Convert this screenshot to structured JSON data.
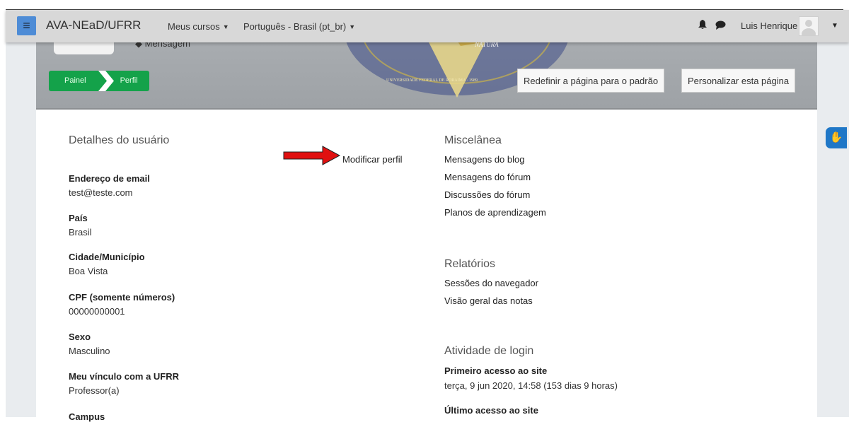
{
  "navbar": {
    "brand": "AVA-NEaD/UFRR",
    "menu_courses": "Meus cursos",
    "menu_language": "Português - Brasil (pt_br)",
    "user_name": "Luis Henrique"
  },
  "header": {
    "message_link": "Mensagem",
    "breadcrumb": [
      "Painel",
      "Perfil"
    ],
    "reset_button": "Redefinir a página para o padrão",
    "customize_button": "Personalizar esta página",
    "logo_text_top": "NATURA",
    "logo_text_ring": "UNIVERSIDADE FEDERAL DE RORAIMA · 1989"
  },
  "user_details": {
    "title": "Detalhes do usuário",
    "edit_link": "Modificar perfil",
    "fields": [
      {
        "label": "Endereço de email",
        "value": "test@teste.com"
      },
      {
        "label": "País",
        "value": "Brasil"
      },
      {
        "label": "Cidade/Município",
        "value": "Boa Vista"
      },
      {
        "label": "CPF (somente números)",
        "value": "00000000001"
      },
      {
        "label": "Sexo",
        "value": "Masculino"
      },
      {
        "label": "Meu vínculo com a UFRR",
        "value": "Professor(a)"
      },
      {
        "label": "Campus",
        "value": ""
      }
    ]
  },
  "misc": {
    "title": "Miscelânea",
    "links": [
      "Mensagens do blog",
      "Mensagens do fórum",
      "Discussões do fórum",
      "Planos de aprendizagem"
    ]
  },
  "reports": {
    "title": "Relatórios",
    "links": [
      "Sessões do navegador",
      "Visão geral das notas"
    ]
  },
  "login_activity": {
    "title": "Atividade de login",
    "first_access_label": "Primeiro acesso ao site",
    "first_access_value": "terça, 9 jun 2020, 14:58  (153 dias 9 horas)",
    "last_access_label": "Último acesso ao site"
  },
  "colors": {
    "breadcrumb_green": "#14a24a",
    "toggle_blue": "#4e8cd6",
    "arrow_red": "#e01010"
  }
}
